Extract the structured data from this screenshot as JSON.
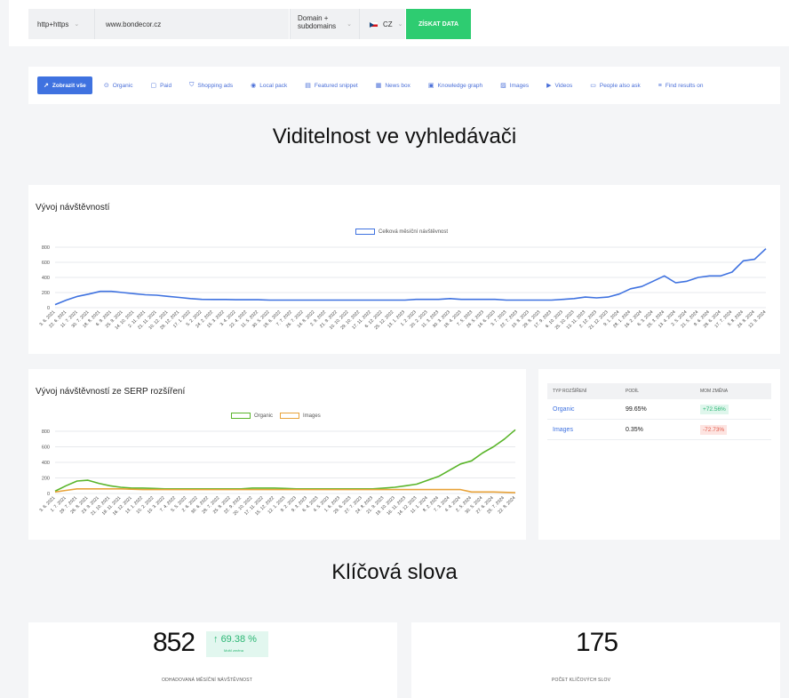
{
  "topbar": {
    "protocol": "http+https",
    "url": "www.bondecor.cz",
    "scope_line1": "Domain +",
    "scope_line2": "subdomains",
    "country": "CZ",
    "submit_label": "ZÍSKAT DATA"
  },
  "filters": [
    {
      "label": "Zobrazit vše",
      "icon": "↗",
      "active": true
    },
    {
      "label": "Organic",
      "icon": "⊙"
    },
    {
      "label": "Paid",
      "icon": "▢"
    },
    {
      "label": "Shopping ads",
      "icon": "⛉"
    },
    {
      "label": "Local pack",
      "icon": "◉"
    },
    {
      "label": "Featured snippet",
      "icon": "▤"
    },
    {
      "label": "News box",
      "icon": "▦"
    },
    {
      "label": "Knowledge graph",
      "icon": "▣"
    },
    {
      "label": "Images",
      "icon": "▨"
    },
    {
      "label": "Videos",
      "icon": "▶"
    },
    {
      "label": "People also ask",
      "icon": "▭"
    },
    {
      "label": "Find results on",
      "icon": "≡"
    }
  ],
  "visibility": {
    "title": "Viditelnost ve vyhledávači"
  },
  "traffic_chart": {
    "title": "Vývoj návštěvností",
    "legend": "Celková měsíční návštěvnost"
  },
  "serp_chart": {
    "title": "Vývoj návštěvností ze SERP rozšíření",
    "legend_organic": "Organic",
    "legend_images": "Images"
  },
  "serp_table": {
    "headers": [
      "TYP ROZŠÍŘENÍ",
      "PODÍL",
      "MOM ZMĚNA"
    ],
    "rows": [
      {
        "type": "Organic",
        "share": "99.65%",
        "change": "+72.56%",
        "dir": "up"
      },
      {
        "type": "Images",
        "share": "0.35%",
        "change": "-72.73%",
        "dir": "down"
      }
    ]
  },
  "keywords": {
    "title": "Klíčová slova"
  },
  "stats": {
    "visits_value": "852",
    "visits_change": "69.38 %",
    "visits_change_label": "MoM změna",
    "visits_label": "ODHADOVANÁ MĚSÍČNÍ NÁVŠTĚVNOST",
    "keywords_value": "175",
    "keywords_label": "POČET KLÍČOVÝCH SLOV"
  },
  "colors": {
    "accent": "#3f72e0",
    "organic": "#5ab52a",
    "images": "#e8a33a",
    "success": "#2ecc71"
  },
  "chart_data": [
    {
      "type": "line",
      "ylim": [
        0,
        800
      ],
      "yticks": [
        0,
        200,
        400,
        600,
        800
      ],
      "x": [
        "3. 6. 2021",
        "22. 6. 2021",
        "11. 7. 2021",
        "30. 7. 2021",
        "18. 8. 2021",
        "6. 9. 2021",
        "25. 9. 2021",
        "14. 10. 2021",
        "2. 11. 2021",
        "21. 11. 2021",
        "10. 12. 2021",
        "29. 12. 2021",
        "17. 1. 2022",
        "5. 2. 2022",
        "24. 2. 2022",
        "15. 3. 2022",
        "3. 4. 2022",
        "22. 4. 2022",
        "11. 5. 2022",
        "30. 5. 2022",
        "18. 6. 2022",
        "7. 7. 2022",
        "26. 7. 2022",
        "14. 8. 2022",
        "2. 9. 2022",
        "21. 9. 2022",
        "10. 10. 2022",
        "29. 10. 2022",
        "17. 11. 2022",
        "6. 12. 2022",
        "25. 12. 2022",
        "13. 1. 2023",
        "1. 2. 2023",
        "20. 2. 2023",
        "11. 3. 2023",
        "30. 3. 2023",
        "18. 4. 2023",
        "7. 5. 2023",
        "26. 5. 2023",
        "14. 6. 2023",
        "3. 7. 2023",
        "22. 7. 2023",
        "10. 8. 2023",
        "29. 8. 2023",
        "17. 9. 2023",
        "6. 10. 2023",
        "25. 10. 2023",
        "13. 11. 2023",
        "2. 12. 2023",
        "21. 12. 2023",
        "9. 1. 2024",
        "28. 1. 2024",
        "16. 2. 2024",
        "6. 3. 2024",
        "25. 3. 2024",
        "13. 4. 2024",
        "2. 5. 2024",
        "21. 5. 2024",
        "9. 6. 2024",
        "28. 6. 2024",
        "17. 7. 2024",
        "5. 8. 2024",
        "24. 8. 2024",
        "12. 9. 2024"
      ],
      "series": [
        {
          "name": "Celková měsíční návštěvnost",
          "color": "#3f72e0",
          "values": [
            40,
            100,
            150,
            180,
            215,
            215,
            200,
            185,
            170,
            165,
            150,
            135,
            120,
            110,
            108,
            108,
            105,
            105,
            105,
            100,
            100,
            100,
            100,
            100,
            100,
            100,
            100,
            100,
            100,
            100,
            100,
            100,
            110,
            110,
            110,
            120,
            110,
            110,
            110,
            110,
            100,
            100,
            100,
            100,
            100,
            110,
            120,
            140,
            130,
            140,
            180,
            250,
            280,
            350,
            420,
            330,
            350,
            400,
            420,
            420,
            470,
            620,
            640,
            780
          ]
        }
      ]
    },
    {
      "type": "line",
      "ylim": [
        0,
        800
      ],
      "yticks": [
        0,
        200,
        400,
        600,
        800
      ],
      "x": [
        "3. 6. 2021",
        "1. 7. 2021",
        "29. 7. 2021",
        "26. 8. 2021",
        "23. 9. 2021",
        "21. 10. 2021",
        "18. 11. 2021",
        "16. 12. 2021",
        "13. 1. 2022",
        "10. 2. 2022",
        "10. 3. 2022",
        "7. 4. 2022",
        "5. 5. 2022",
        "2. 6. 2022",
        "30. 6. 2022",
        "28. 7. 2022",
        "25. 8. 2022",
        "22. 9. 2022",
        "20. 10. 2022",
        "17. 11. 2022",
        "15. 12. 2022",
        "12. 1. 2023",
        "9. 2. 2023",
        "9. 3. 2023",
        "6. 4. 2023",
        "4. 5. 2023",
        "1. 6. 2023",
        "29. 6. 2023",
        "27. 7. 2023",
        "24. 8. 2023",
        "21. 9. 2023",
        "19. 10. 2023",
        "16. 11. 2023",
        "14. 12. 2023",
        "11. 1. 2024",
        "8. 2. 2024",
        "7. 3. 2024",
        "4. 4. 2024",
        "2. 5. 2024",
        "30. 5. 2024",
        "27. 6. 2024",
        "25. 7. 2024",
        "22. 8. 2024"
      ],
      "series": [
        {
          "name": "Organic",
          "color": "#5ab52a",
          "values": [
            30,
            100,
            160,
            170,
            130,
            100,
            80,
            70,
            70,
            65,
            60,
            60,
            60,
            60,
            60,
            60,
            60,
            60,
            70,
            70,
            70,
            65,
            60,
            60,
            60,
            60,
            60,
            60,
            60,
            60,
            70,
            80,
            100,
            120,
            170,
            220,
            300,
            380,
            420,
            520,
            600,
            700,
            820
          ]
        },
        {
          "name": "Images",
          "color": "#e8a33a",
          "values": [
            20,
            40,
            60,
            60,
            60,
            60,
            60,
            55,
            50,
            50,
            50,
            50,
            50,
            50,
            50,
            50,
            50,
            50,
            50,
            50,
            50,
            50,
            50,
            50,
            50,
            50,
            50,
            50,
            50,
            50,
            50,
            50,
            50,
            50,
            50,
            50,
            50,
            50,
            20,
            20,
            20,
            15,
            10
          ]
        }
      ]
    }
  ]
}
